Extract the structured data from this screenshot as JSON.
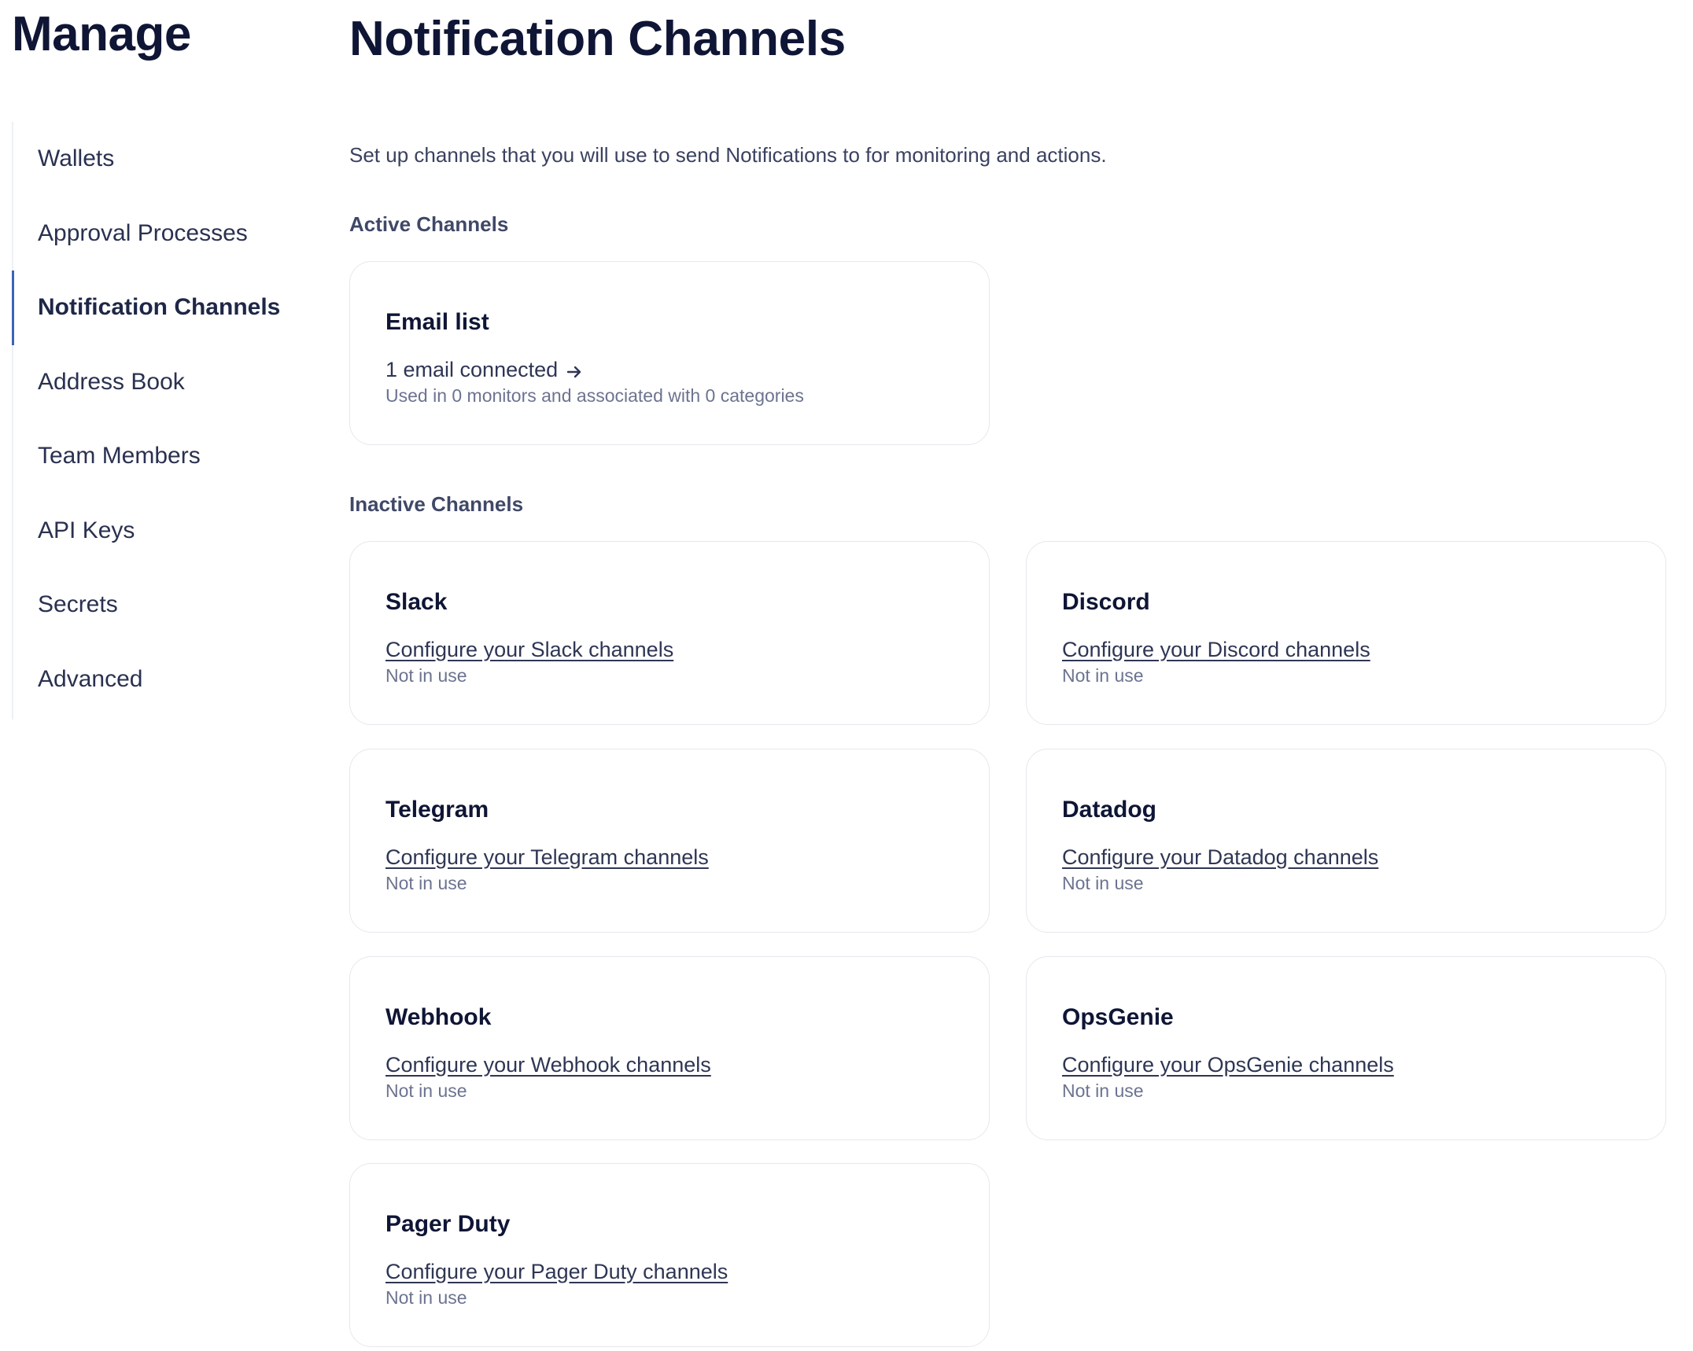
{
  "sidebar": {
    "title": "Manage",
    "items": [
      {
        "label": "Wallets"
      },
      {
        "label": "Approval Processes"
      },
      {
        "label": "Notification Channels"
      },
      {
        "label": "Address Book"
      },
      {
        "label": "Team Members"
      },
      {
        "label": "API Keys"
      },
      {
        "label": "Secrets"
      },
      {
        "label": "Advanced"
      }
    ],
    "active_index": 2
  },
  "main": {
    "title": "Notification Channels",
    "intro": "Set up channels that you will use to send Notifications to for monitoring and actions.",
    "active_section": {
      "label": "Active Channels",
      "cards": [
        {
          "title": "Email list",
          "link": "1 email connected",
          "sub": "Used in 0 monitors and associated with 0 categories",
          "link_icon": "arrow-right-icon"
        }
      ]
    },
    "inactive_section": {
      "label": "Inactive Channels",
      "cards": [
        {
          "title": "Slack",
          "link": "Configure your Slack channels",
          "sub": "Not in use"
        },
        {
          "title": "Discord",
          "link": "Configure your Discord channels",
          "sub": "Not in use"
        },
        {
          "title": "Telegram",
          "link": "Configure your Telegram channels",
          "sub": "Not in use"
        },
        {
          "title": "Datadog",
          "link": "Configure your Datadog channels",
          "sub": "Not in use"
        },
        {
          "title": "Webhook",
          "link": "Configure your Webhook channels",
          "sub": "Not in use"
        },
        {
          "title": "OpsGenie",
          "link": "Configure your OpsGenie channels",
          "sub": "Not in use"
        },
        {
          "title": "Pager Duty",
          "link": "Configure your Pager Duty channels",
          "sub": "Not in use"
        }
      ]
    }
  },
  "colors": {
    "accent": "#3c64b4",
    "heading": "#0f1535",
    "border": "#e6e8ee"
  }
}
